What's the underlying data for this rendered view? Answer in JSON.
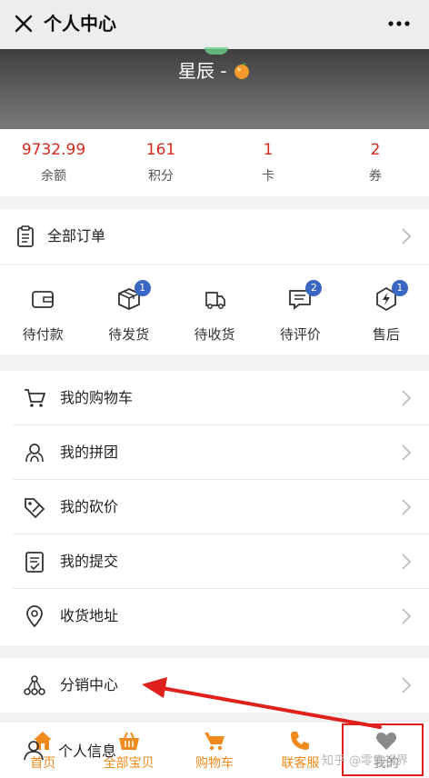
{
  "header": {
    "title": "个人中心",
    "close_icon": "close-icon",
    "more_icon": "more-icon"
  },
  "profile": {
    "name": "星辰 -"
  },
  "stats": [
    {
      "value": "9732.99",
      "label": "余额"
    },
    {
      "value": "161",
      "label": "积分"
    },
    {
      "value": "1",
      "label": "卡"
    },
    {
      "value": "2",
      "label": "券"
    }
  ],
  "all_orders": {
    "label": "全部订单"
  },
  "order_tabs": [
    {
      "label": "待付款",
      "icon": "wallet-icon",
      "badge": ""
    },
    {
      "label": "待发货",
      "icon": "package-icon",
      "badge": "1"
    },
    {
      "label": "待收货",
      "icon": "truck-icon",
      "badge": ""
    },
    {
      "label": "待评价",
      "icon": "review-icon",
      "badge": "2"
    },
    {
      "label": "售后",
      "icon": "after-sales-icon",
      "badge": "1"
    }
  ],
  "menu": [
    {
      "label": "我的购物车",
      "icon": "cart-icon"
    },
    {
      "label": "我的拼团",
      "icon": "group-icon"
    },
    {
      "label": "我的砍价",
      "icon": "bargain-tag-icon"
    },
    {
      "label": "我的提交",
      "icon": "submission-icon"
    },
    {
      "label": "收货地址",
      "icon": "location-icon"
    }
  ],
  "distribution": {
    "label": "分销中心"
  },
  "personal_info": {
    "label": "个人信息"
  },
  "tabbar": [
    {
      "label": "首页",
      "icon": "home-icon"
    },
    {
      "label": "全部宝贝",
      "icon": "basket-icon"
    },
    {
      "label": "购物车",
      "icon": "cart-icon"
    },
    {
      "label": "联客服",
      "icon": "phone-icon"
    },
    {
      "label": "我的",
      "icon": "heart-icon"
    }
  ],
  "watermark": "知乎 @零售视界",
  "colors": {
    "accent": "#f08a1c",
    "price_red": "#d42a1e",
    "badge_blue": "#3a66c4",
    "highlight_red": "#e0201c"
  }
}
